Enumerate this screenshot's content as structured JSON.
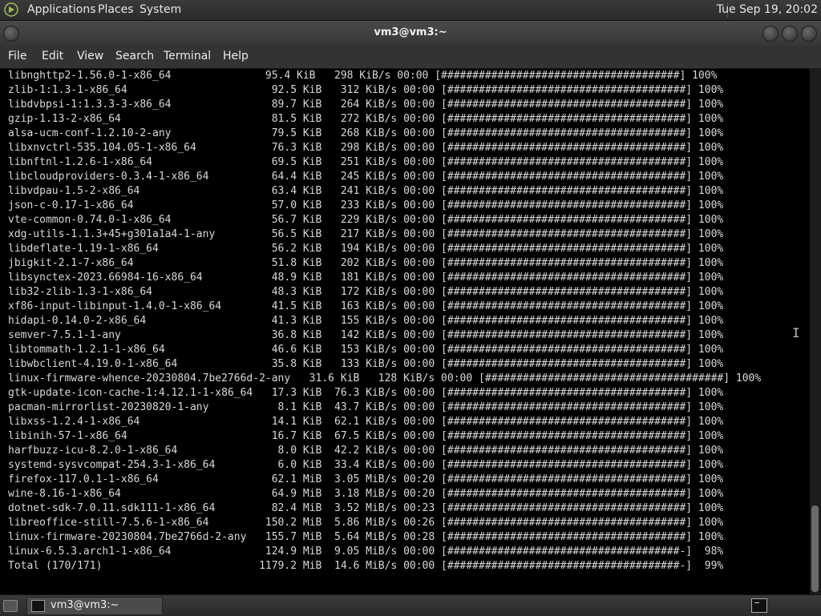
{
  "top_panel": {
    "menus": [
      "Applications",
      "Places",
      "System"
    ],
    "clock": "Tue Sep 19, 20:02"
  },
  "window": {
    "title": "vm3@vm3:~"
  },
  "menubar": [
    "File",
    "Edit",
    "View",
    "Search",
    "Terminal",
    "Help"
  ],
  "terminal": {
    "lines": [
      " libnghttp2-1.56.0-1-x86_64               95.4 KiB   298 KiB/s 00:00 [######################################] 100%",
      " zlib-1:1.3-1-x86_64                       92.5 KiB   312 KiB/s 00:00 [######################################] 100%",
      " libdvbpsi-1:1.3.3-3-x86_64                89.7 KiB   264 KiB/s 00:00 [######################################] 100%",
      " gzip-1.13-2-x86_64                        81.5 KiB   272 KiB/s 00:00 [######################################] 100%",
      " alsa-ucm-conf-1.2.10-2-any                79.5 KiB   268 KiB/s 00:00 [######################################] 100%",
      " libxnvctrl-535.104.05-1-x86_64            76.3 KiB   298 KiB/s 00:00 [######################################] 100%",
      " libnftnl-1.2.6-1-x86_64                   69.5 KiB   251 KiB/s 00:00 [######################################] 100%",
      " libcloudproviders-0.3.4-1-x86_64          64.4 KiB   245 KiB/s 00:00 [######################################] 100%",
      " libvdpau-1.5-2-x86_64                     63.4 KiB   241 KiB/s 00:00 [######################################] 100%",
      " json-c-0.17-1-x86_64                      57.0 KiB   233 KiB/s 00:00 [######################################] 100%",
      " vte-common-0.74.0-1-x86_64                56.7 KiB   229 KiB/s 00:00 [######################################] 100%",
      " xdg-utils-1.1.3+45+g301a1a4-1-any         56.5 KiB   217 KiB/s 00:00 [######################################] 100%",
      " libdeflate-1.19-1-x86_64                  56.2 KiB   194 KiB/s 00:00 [######################################] 100%",
      " jbigkit-2.1-7-x86_64                      51.8 KiB   202 KiB/s 00:00 [######################################] 100%",
      " libsynctex-2023.66984-16-x86_64           48.9 KiB   181 KiB/s 00:00 [######################################] 100%",
      " lib32-zlib-1.3-1-x86_64                   48.3 KiB   172 KiB/s 00:00 [######################################] 100%",
      " xf86-input-libinput-1.4.0-1-x86_64        41.5 KiB   163 KiB/s 00:00 [######################################] 100%",
      " hidapi-0.14.0-2-x86_64                    41.3 KiB   155 KiB/s 00:00 [######################################] 100%",
      " semver-7.5.1-1-any                        36.8 KiB   142 KiB/s 00:00 [######################################] 100%",
      " libtommath-1.2.1-1-x86_64                 46.6 KiB   153 KiB/s 00:00 [######################################] 100%",
      " libwbclient-4.19.0-1-x86_64               35.8 KiB   133 KiB/s 00:00 [######################################] 100%",
      " linux-firmware-whence-20230804.7be2766d-2-any     31.6 KiB   128 KiB/s 00:00 [######################################] 100%",
      " gtk-update-icon-cache-1:4.12.1-1-x86_64   17.3 KiB  76.3 KiB/s 00:00 [######################################] 100%",
      " pacman-mirrorlist-20230820-1-any           8.1 KiB  43.7 KiB/s 00:00 [######################################] 100%",
      " libxss-1.2.4-1-x86_64                     14.1 KiB  62.1 KiB/s 00:00 [######################################] 100%",
      " libinih-57-1-x86_64                       16.7 KiB  67.5 KiB/s 00:00 [######################################] 100%",
      " harfbuzz-icu-8.2.0-1-x86_64                8.0 KiB  42.2 KiB/s 00:00 [######################################] 100%",
      " systemd-sysvcompat-254.3-1-x86_64          6.0 KiB  33.4 KiB/s 00:00 [######################################] 100%",
      " firefox-117.0.1-1-x86_64                  62.1 MiB  3.05 MiB/s 00:20 [######################################] 100%",
      " wine-8.16-1-x86_64                        64.9 MiB  3.18 MiB/s 00:20 [######################################] 100%",
      " dotnet-sdk-7.0.11.sdk111-1-x86_64         82.4 MiB  3.52 MiB/s 00:23 [######################################] 100%",
      " libreoffice-still-7.5.6-1-x86_64         150.2 MiB  5.86 MiB/s 00:26 [######################################] 100%",
      " linux-firmware-20230804.7be2766d-2-any   155.7 MiB  5.64 MiB/s 00:28 [######################################] 100%",
      " linux-6.5.3.arch1-1-x86_64               124.9 MiB  9.05 MiB/s 00:00 [#####################################-]  98%",
      " Total (170/171)                         1179.2 MiB  14.6 MiB/s 00:00 [#####################################-]  99%"
    ]
  },
  "taskbar": {
    "task_label": "vm3@vm3:~"
  },
  "colors": {
    "panel": "#2b2b2b",
    "terminal_bg": "#000000",
    "terminal_fg": "#d8d8d8"
  }
}
